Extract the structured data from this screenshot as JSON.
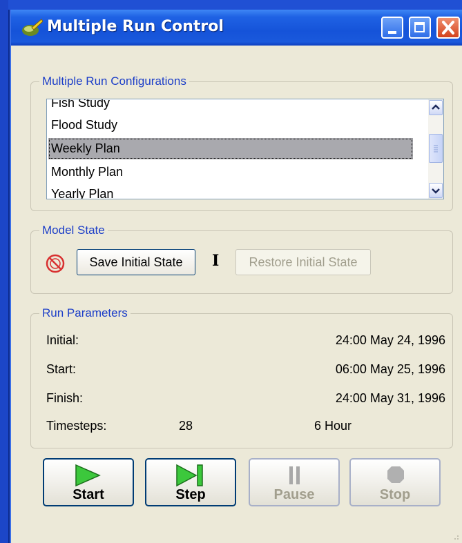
{
  "window": {
    "title": "Multiple Run Control"
  },
  "configs": {
    "legend": "Multiple Run Configurations",
    "items": [
      "Fish Study",
      "Flood Study",
      "Weekly Plan",
      "Monthly Plan",
      "Yearly Plan"
    ],
    "selected": "Weekly Plan"
  },
  "model_state": {
    "legend": "Model State",
    "save_label": "Save Initial State",
    "restore_label": "Restore Initial State"
  },
  "run_params": {
    "legend": "Run Parameters",
    "initial_label": "Initial:",
    "initial_value": "24:00 May 24, 1996",
    "start_label": "Start:",
    "start_value": "06:00 May 25, 1996",
    "finish_label": "Finish:",
    "finish_value": "24:00 May 31, 1996",
    "timesteps_label": "Timesteps:",
    "timesteps_count": "28",
    "timestep_size": "6 Hour"
  },
  "controls": {
    "start_label": "Start",
    "step_label": "Step",
    "pause_label": "Pause",
    "stop_label": "Stop"
  },
  "colors": {
    "accent": "#1c3ec8",
    "titlebar": "#1553d9",
    "play_green": "#3cc83c"
  },
  "icons": [
    "app-icon",
    "minimize-icon",
    "maximize-icon",
    "close-icon",
    "no-save-icon",
    "play-icon",
    "step-icon",
    "pause-icon",
    "stop-icon"
  ]
}
